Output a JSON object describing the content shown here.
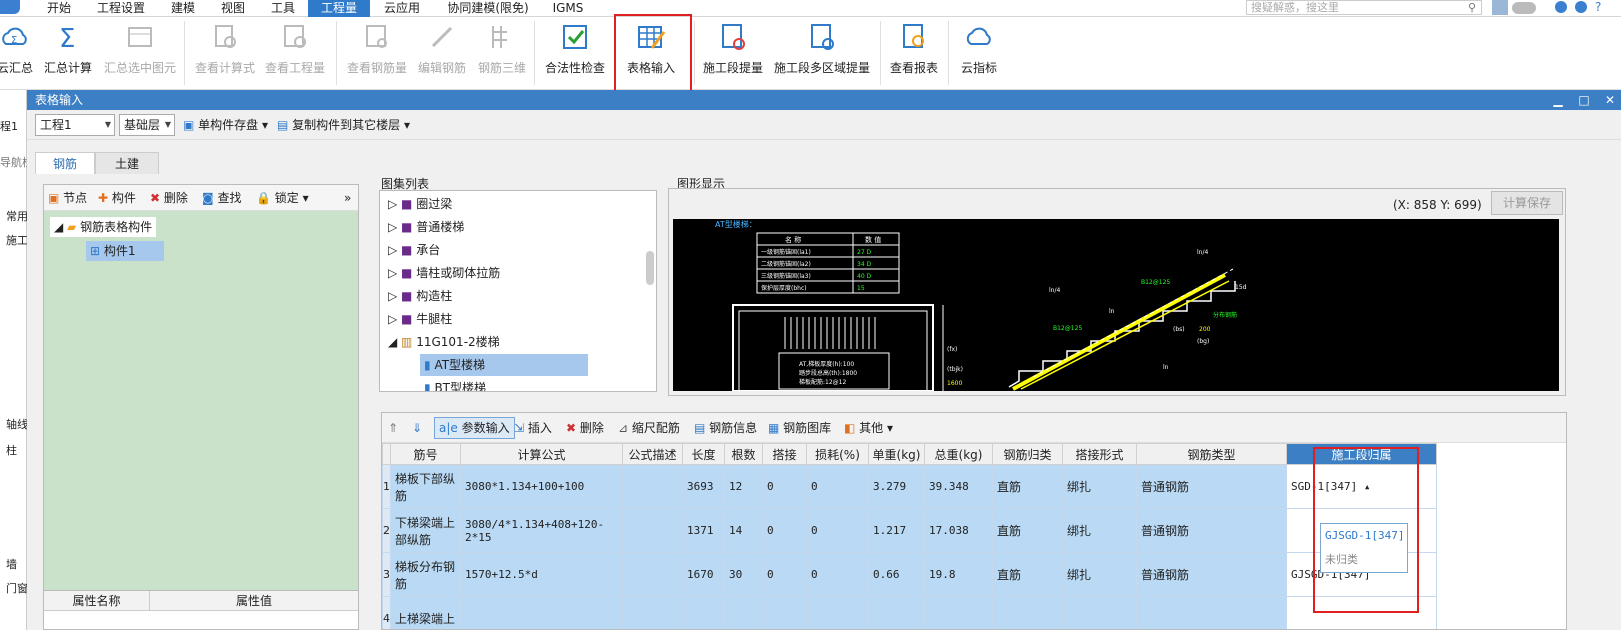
{
  "menubar": {
    "items": [
      "开始",
      "工程设置",
      "建模",
      "视图",
      "工具",
      "工程量",
      "云应用",
      "协同建模(限免)",
      "IGMS"
    ],
    "active_index": 5,
    "search_placeholder": "搜疑解惑，搜这里"
  },
  "ribbon": {
    "buttons": [
      "云汇总",
      "汇总计算",
      "汇总选中图元",
      "查看计算式",
      "查看工程量",
      "查看钢筋量",
      "编辑钢筋",
      "钢筋三维",
      "合法性检查",
      "表格输入",
      "施工段提量",
      "施工段多区域提量",
      "查看报表",
      "云指标"
    ]
  },
  "left_strip": {
    "items": [
      "程1",
      "导航栏",
      "常用",
      "施工",
      "轴线",
      "柱",
      "墙",
      "门窗"
    ]
  },
  "window": {
    "title": "表格输入",
    "controls": [
      "▁",
      "□",
      "✕"
    ],
    "project_select": "工程1",
    "floor_select": "基础层",
    "save_single": "单构件存盘",
    "copy_to_floor": "复制构件到其它楼层",
    "tabs": [
      "钢筋",
      "土建"
    ]
  },
  "left_panel": {
    "toolbar": [
      "节点",
      "构件",
      "删除",
      "查找",
      "锁定"
    ],
    "tree": {
      "root": "钢筋表格构件",
      "child": "构件1"
    },
    "props_headers": [
      "属性名称",
      "属性值"
    ]
  },
  "atlas": {
    "label": "图集列表",
    "items": [
      "圈过梁",
      "普通楼梯",
      "承台",
      "墙柱或砌体拉筋",
      "构造柱",
      "牛腿柱",
      "11G101-2楼梯",
      "AT型楼梯",
      "BT型楼梯"
    ]
  },
  "graphic": {
    "label": "图形显示",
    "coords": "(X: 858 Y: 699)",
    "calc_save": "计算保存",
    "drawing_title": "AT型楼梯：",
    "table_head": [
      "名 称",
      "数 值"
    ],
    "table_rows": [
      [
        "一级钢筋锚固(la1)",
        "27 D"
      ],
      [
        "二级钢筋锚固(la2)",
        "34 D"
      ],
      [
        "三级钢筋锚固(la3)",
        "40 D"
      ],
      [
        "保护层厚度(bhc)",
        "15"
      ]
    ],
    "notes": [
      "AT,梯板厚度(h):100",
      "踏步段总高(th):1800",
      "梯板配筋:12@12"
    ],
    "marks": [
      "ln/4",
      "ln",
      "ln/4",
      "ln",
      "B12@125",
      "B12@125",
      "(bs)",
      "(tbjk)",
      "1600",
      "200",
      "(bg)",
      "15d",
      "分布钢筋",
      "(fx)"
    ]
  },
  "table": {
    "toolbar": [
      "参数输入",
      "插入",
      "删除",
      "缩尺配筋",
      "钢筋信息",
      "钢筋图库",
      "其他"
    ],
    "headers": [
      "筋号",
      "计算公式",
      "公式描述",
      "长度",
      "根数",
      "搭接",
      "损耗(%)",
      "单重(kg)",
      "总重(kg)",
      "钢筋归类",
      "搭接形式",
      "钢筋类型",
      "施工段归属"
    ],
    "rows": [
      {
        "no": "1",
        "name": "梯板下部纵筋",
        "formula": "3080*1.134+100+100",
        "desc": "",
        "len": "3693",
        "count": "12",
        "lap": "0",
        "loss": "0",
        "unit": "3.279",
        "total": "39.348",
        "cls": "直筋",
        "lapform": "绑扎",
        "type": "普通钢筋",
        "seg": "SGD-1[347]"
      },
      {
        "no": "2",
        "name": "下梯梁端上部纵筋",
        "formula": "3080/4*1.134+408+120-2*15",
        "desc": "",
        "len": "1371",
        "count": "14",
        "lap": "0",
        "loss": "0",
        "unit": "1.217",
        "total": "17.038",
        "cls": "直筋",
        "lapform": "绑扎",
        "type": "普通钢筋",
        "seg": ""
      },
      {
        "no": "3",
        "name": "梯板分布钢筋",
        "formula": "1570+12.5*d",
        "desc": "",
        "len": "1670",
        "count": "30",
        "lap": "0",
        "loss": "0",
        "unit": "0.66",
        "total": "19.8",
        "cls": "直筋",
        "lapform": "绑扎",
        "type": "普通钢筋",
        "seg": "GJSGD-1[347]"
      },
      {
        "no": "4",
        "name": "上梯梁端上",
        "formula": "",
        "desc": "",
        "len": "",
        "count": "",
        "lap": "",
        "loss": "",
        "unit": "",
        "total": "",
        "cls": "",
        "lapform": "",
        "type": "",
        "seg": ""
      }
    ],
    "dropdown_options": [
      "GJSGD-1[347]",
      "未归类"
    ]
  }
}
